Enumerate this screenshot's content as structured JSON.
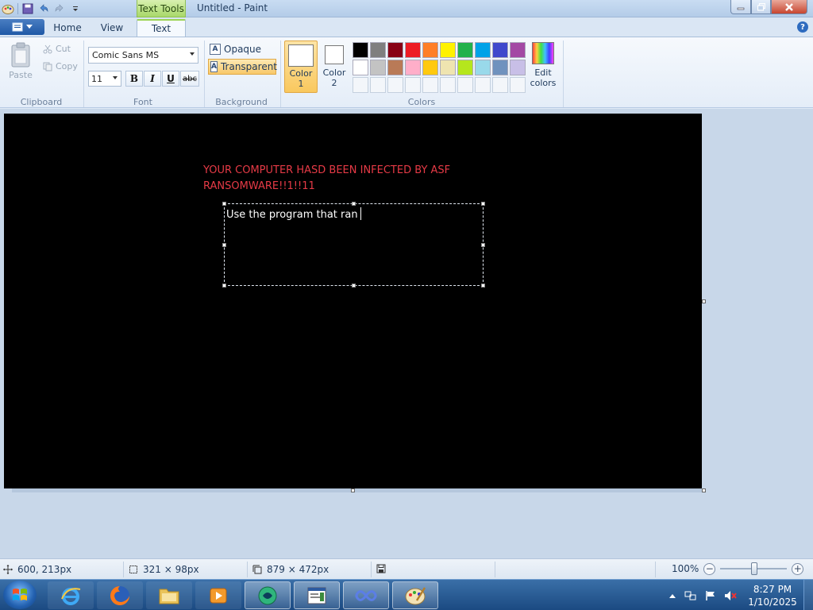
{
  "window": {
    "title": "Untitled - Paint",
    "context_tab": "Text Tools"
  },
  "tabs": {
    "home": "Home",
    "view": "View",
    "text": "Text",
    "active": "Text"
  },
  "clipboard": {
    "paste": "Paste",
    "cut": "Cut",
    "copy": "Copy",
    "group": "Clipboard"
  },
  "font": {
    "family": "Comic Sans MS",
    "size": "11",
    "bold": "B",
    "italic": "I",
    "underline": "U",
    "strikethrough": "abc",
    "group": "Font"
  },
  "background": {
    "opaque": "Opaque",
    "transparent": "Transparent",
    "selected": "Transparent",
    "group": "Background"
  },
  "colors": {
    "color1": {
      "line1": "Color",
      "line2": "1",
      "value": "#ffffff"
    },
    "color2": {
      "line1": "Color",
      "line2": "2",
      "value": "#ffffff"
    },
    "palette_row1": [
      "#000000",
      "#7f7f7f",
      "#880015",
      "#ed1c24",
      "#ff7f27",
      "#fff200",
      "#22b14c",
      "#00a2e8",
      "#3f48cc",
      "#a349a4"
    ],
    "palette_row2": [
      "#ffffff",
      "#c3c3c3",
      "#b97a57",
      "#ffaec9",
      "#ffc90e",
      "#efe4b0",
      "#b5e61d",
      "#99d9ea",
      "#7092be",
      "#c8bfe7"
    ],
    "edit_line1": "Edit",
    "edit_line2": "colors",
    "group": "Colors"
  },
  "canvas": {
    "heading_line1": "YOUR COMPUTER HASD BEEN INFECTED BY ASF",
    "heading_line2": "RANSOMWARE!!1!!11",
    "textbox_text": "Use the program that ran",
    "background_color": "#000000",
    "heading_color": "#e63a46"
  },
  "status": {
    "cursor_pos": "600, 213px",
    "selection_size": "321 × 98px",
    "canvas_size": "879 × 472px",
    "zoom": "100%",
    "zoom_level": 1.0
  },
  "taskbar": {
    "apps": [
      "internet-explorer",
      "firefox",
      "file-explorer",
      "media-player",
      "app-green",
      "notepad-window",
      "app-infinity",
      "paint"
    ],
    "time": "8:27 PM",
    "date": "1/10/2025"
  }
}
